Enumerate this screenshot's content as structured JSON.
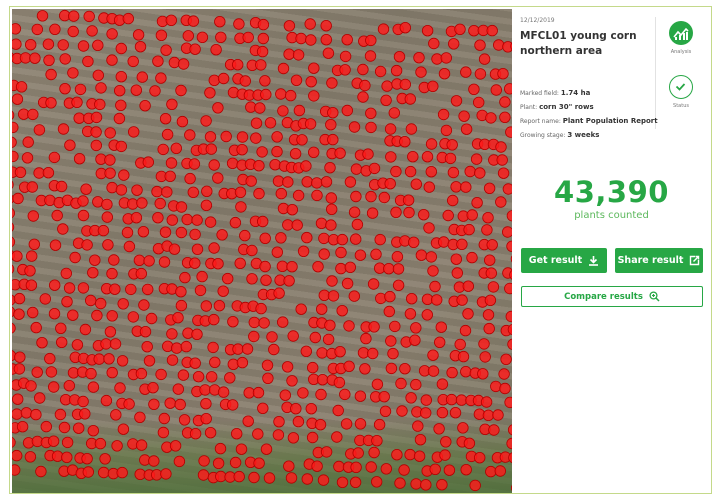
{
  "map": {
    "marker_color": "#ff1a1a",
    "soil_color": "#8b8270"
  },
  "panel": {
    "date": "12/12/2019",
    "title": "MFCL01 young corn northern area",
    "analysis_label": "Analysis",
    "status_label": "Status",
    "info": [
      {
        "label": "Marked field:",
        "value": "1.74 ha"
      },
      {
        "label": "Plant:",
        "value": "corn 30\" rows"
      },
      {
        "label": "Report name:",
        "value": "Plant Population Report"
      },
      {
        "label": "Growing stage:",
        "value": "3 weeks"
      }
    ],
    "count": "43,390",
    "count_label": "plants counted",
    "buttons": {
      "get_result": "Get result",
      "share_result": "Share result",
      "compare_results": "Compare results"
    },
    "icons": {
      "analysis": "chart-analysis-icon",
      "status": "checkmark-icon",
      "download": "download-icon",
      "share": "share-icon",
      "compare": "magnifier-plus-icon"
    },
    "accent_color": "#27a745"
  }
}
